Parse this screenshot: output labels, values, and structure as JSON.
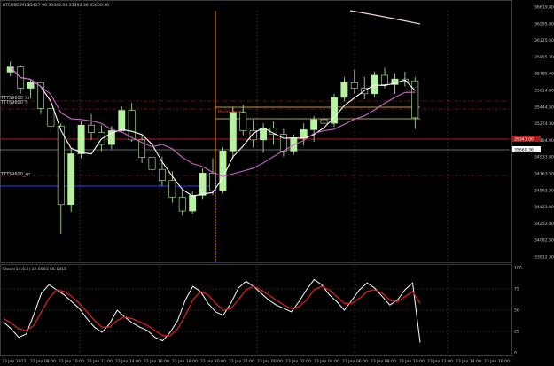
{
  "colors": {
    "background": "#000000",
    "bull_candle": "#b6f2a0",
    "bear_candle": "#b6f2a0",
    "grid": "#5a5a5a",
    "ma_fast": "#ffffff",
    "ma_slow": "#cc66cc",
    "pivot_line": "#e6d36a",
    "support_red": "#b01818",
    "blue_level": "#2a3cff",
    "orange_vline": "#ff9900",
    "stoch_main": "#ffffff",
    "stoch_signal": "#d42020",
    "current_price_tag": "#ffffff",
    "pivot_text": "#ff3030"
  },
  "main_chart": {
    "title": "BTCUSD,M15",
    "ohlc": "35427.90 35446.04 35393.36 35660.36",
    "pivot_label": "Pivot Point",
    "left_tags": [
      "TTTS9600_hi",
      "TTTS9600_lt",
      "TTTS9600_sp"
    ],
    "price_axis": [
      "36619.80",
      "36295.80",
      "36125.50",
      "35955.30",
      "35785.00",
      "35614.80",
      "35444.50",
      "35274.30",
      "35104.00",
      "34933.80",
      "34763.50",
      "34593.30",
      "34423.00",
      "34252.80",
      "34082.50",
      "33912.30"
    ],
    "current_price": "35660.36",
    "red_price": "35341.00",
    "chart_data": {
      "type": "candlestick",
      "title": "BTCUSD,M15",
      "ylim": [
        33912.3,
        36619.8
      ],
      "candles": [
        [
          35934,
          36050,
          35890,
          35990
        ],
        [
          35990,
          36010,
          35700,
          35760
        ],
        [
          35760,
          35850,
          35650,
          35820
        ],
        [
          35820,
          35830,
          35480,
          35540
        ],
        [
          35540,
          35620,
          35260,
          35350
        ],
        [
          35350,
          35380,
          34180,
          34500
        ],
        [
          34500,
          35100,
          34420,
          35050
        ],
        [
          35050,
          35400,
          35000,
          35360
        ],
        [
          35360,
          35480,
          35200,
          35280
        ],
        [
          35280,
          35360,
          35080,
          35150
        ],
        [
          35150,
          35350,
          35100,
          35300
        ],
        [
          35300,
          35560,
          35280,
          35520
        ],
        [
          35520,
          35600,
          35180,
          35200
        ],
        [
          35200,
          35260,
          34950,
          35010
        ],
        [
          35010,
          35120,
          34800,
          34880
        ],
        [
          34880,
          35020,
          34700,
          34760
        ],
        [
          34760,
          34860,
          34520,
          34580
        ],
        [
          34580,
          34660,
          34380,
          34430
        ],
        [
          34430,
          34640,
          34400,
          34600
        ],
        [
          34600,
          34890,
          34560,
          34840
        ],
        [
          34840,
          35000,
          34600,
          34650
        ],
        [
          34650,
          35120,
          34620,
          35080
        ],
        [
          35080,
          35560,
          35000,
          35500
        ],
        [
          35500,
          35580,
          35250,
          35300
        ],
        [
          35300,
          35420,
          35120,
          35200
        ],
        [
          35200,
          35380,
          35060,
          35330
        ],
        [
          35330,
          35400,
          35150,
          35260
        ],
        [
          35260,
          35320,
          35020,
          35080
        ],
        [
          35080,
          35260,
          35040,
          35220
        ],
        [
          35220,
          35380,
          35140,
          35310
        ],
        [
          35310,
          35460,
          35180,
          35420
        ],
        [
          35420,
          35560,
          35300,
          35380
        ],
        [
          35380,
          35700,
          35340,
          35660
        ],
        [
          35660,
          35880,
          35620,
          35820
        ],
        [
          35820,
          35960,
          35700,
          35760
        ],
        [
          35760,
          35880,
          35640,
          35700
        ],
        [
          35700,
          35940,
          35660,
          35900
        ],
        [
          35900,
          35980,
          35760,
          35800
        ],
        [
          35800,
          35920,
          35700,
          35860
        ],
        [
          35860,
          35940,
          35780,
          35840
        ],
        [
          35840,
          35880,
          35320,
          35440
        ]
      ],
      "moving_averages": [
        {
          "name": "",
          "color": "#ffffff"
        },
        {
          "name": "",
          "color": "#cc66cc"
        }
      ]
    }
  },
  "oscillator": {
    "title": "Stoch(14,6,2) 12.6063 55.1815",
    "levels": [
      "100",
      "75",
      "50",
      "25",
      "0"
    ],
    "chart_data": {
      "type": "line",
      "title": "Stoch(14,6,2) 12.6063 55.1815",
      "ylim": [
        0,
        100
      ],
      "series": [
        {
          "name": "",
          "values": [
            36,
            28,
            18,
            22,
            45,
            70,
            80,
            74,
            68,
            60,
            52,
            40,
            30,
            24,
            34,
            50,
            42,
            35,
            30,
            26,
            18,
            14,
            24,
            38,
            62,
            78,
            72,
            58,
            48,
            44,
            58,
            76,
            84,
            78,
            70,
            62,
            56,
            52,
            48,
            60,
            74,
            86,
            80,
            68,
            60,
            50,
            62,
            74,
            82,
            76,
            66,
            56,
            62,
            74,
            82,
            12
          ]
        },
        {
          "name": "",
          "values": [
            40,
            35,
            28,
            26,
            32,
            48,
            64,
            74,
            72,
            66,
            58,
            48,
            38,
            30,
            30,
            38,
            42,
            40,
            36,
            32,
            26,
            20,
            20,
            28,
            44,
            62,
            72,
            68,
            58,
            50,
            52,
            62,
            74,
            78,
            74,
            68,
            62,
            56,
            52,
            54,
            62,
            74,
            78,
            74,
            66,
            58,
            58,
            64,
            72,
            74,
            70,
            62,
            60,
            66,
            72,
            58
          ]
        }
      ]
    }
  },
  "time_axis": [
    "23 Jan 2022",
    "22 Jan 08:00",
    "22 Jan 10:00",
    "22 Jan 12:00",
    "22 Jan 14:00",
    "22 Jan 16:00",
    "22 Jan 18:00",
    "22 Jan 20:00",
    "22 Jan 22:00",
    "23 Jan 00:00",
    "23 Jan 02:00",
    "23 Jan 04:00",
    "23 Jan 06:00",
    "23 Jan 08:00",
    "23 Jan 10:00",
    "23 Jan 12:00",
    "23 Jan 14:00",
    "23 Jan 16:00"
  ]
}
